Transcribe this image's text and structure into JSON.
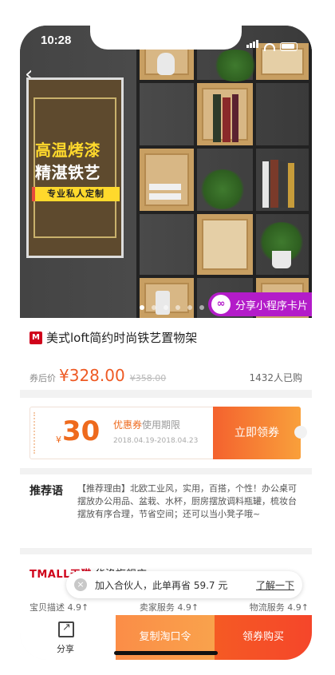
{
  "status": {
    "time": "10:28"
  },
  "hero": {
    "banner_line1": "高温烤漆",
    "banner_line2": "精湛铁艺",
    "banner_tag": "专业私人定制",
    "share_card_label": "分享小程序卡片",
    "share_card_icon": "link-icon",
    "page_indicator": {
      "count": 6,
      "active": 1
    }
  },
  "product": {
    "badge": "M",
    "title": "美式loft简约时尚铁艺置物架",
    "price_label": "券后价",
    "price": "¥328.00",
    "original_price": "¥358.00",
    "sold": "1432人已购"
  },
  "coupon": {
    "currency": "¥",
    "amount": "30",
    "title": "优惠券",
    "subtitle": "使用期限",
    "dates": "2018.04.19-2018.04.23",
    "button": "立即领券"
  },
  "recommend": {
    "heading": "推荐语",
    "text": "【推荐理由】北欧工业风，实用，百搭，个性！办公桌可摆放办公用品、盆栽、水杯，厨房摆放调料瓶罐，梳妆台摆放有序合理，节省空间；还可以当小凳子哦~"
  },
  "shop": {
    "logo": "TMALL天猫",
    "name": "华洛旗舰店",
    "scores": [
      "宝贝描述 4.9↑",
      "卖家服务 4.9↑",
      "物流服务 4.9↑"
    ]
  },
  "toast": {
    "message": "加入合伙人，此单再省 59.7 元",
    "link": "了解一下"
  },
  "bottom_bar": {
    "share_label": "分享",
    "copy_label": "复制淘口令",
    "buy_label": "领券购买"
  },
  "colors": {
    "accent": "#ee5a24",
    "share_card": "#b31cc9",
    "tmall_red": "#d0021b"
  }
}
